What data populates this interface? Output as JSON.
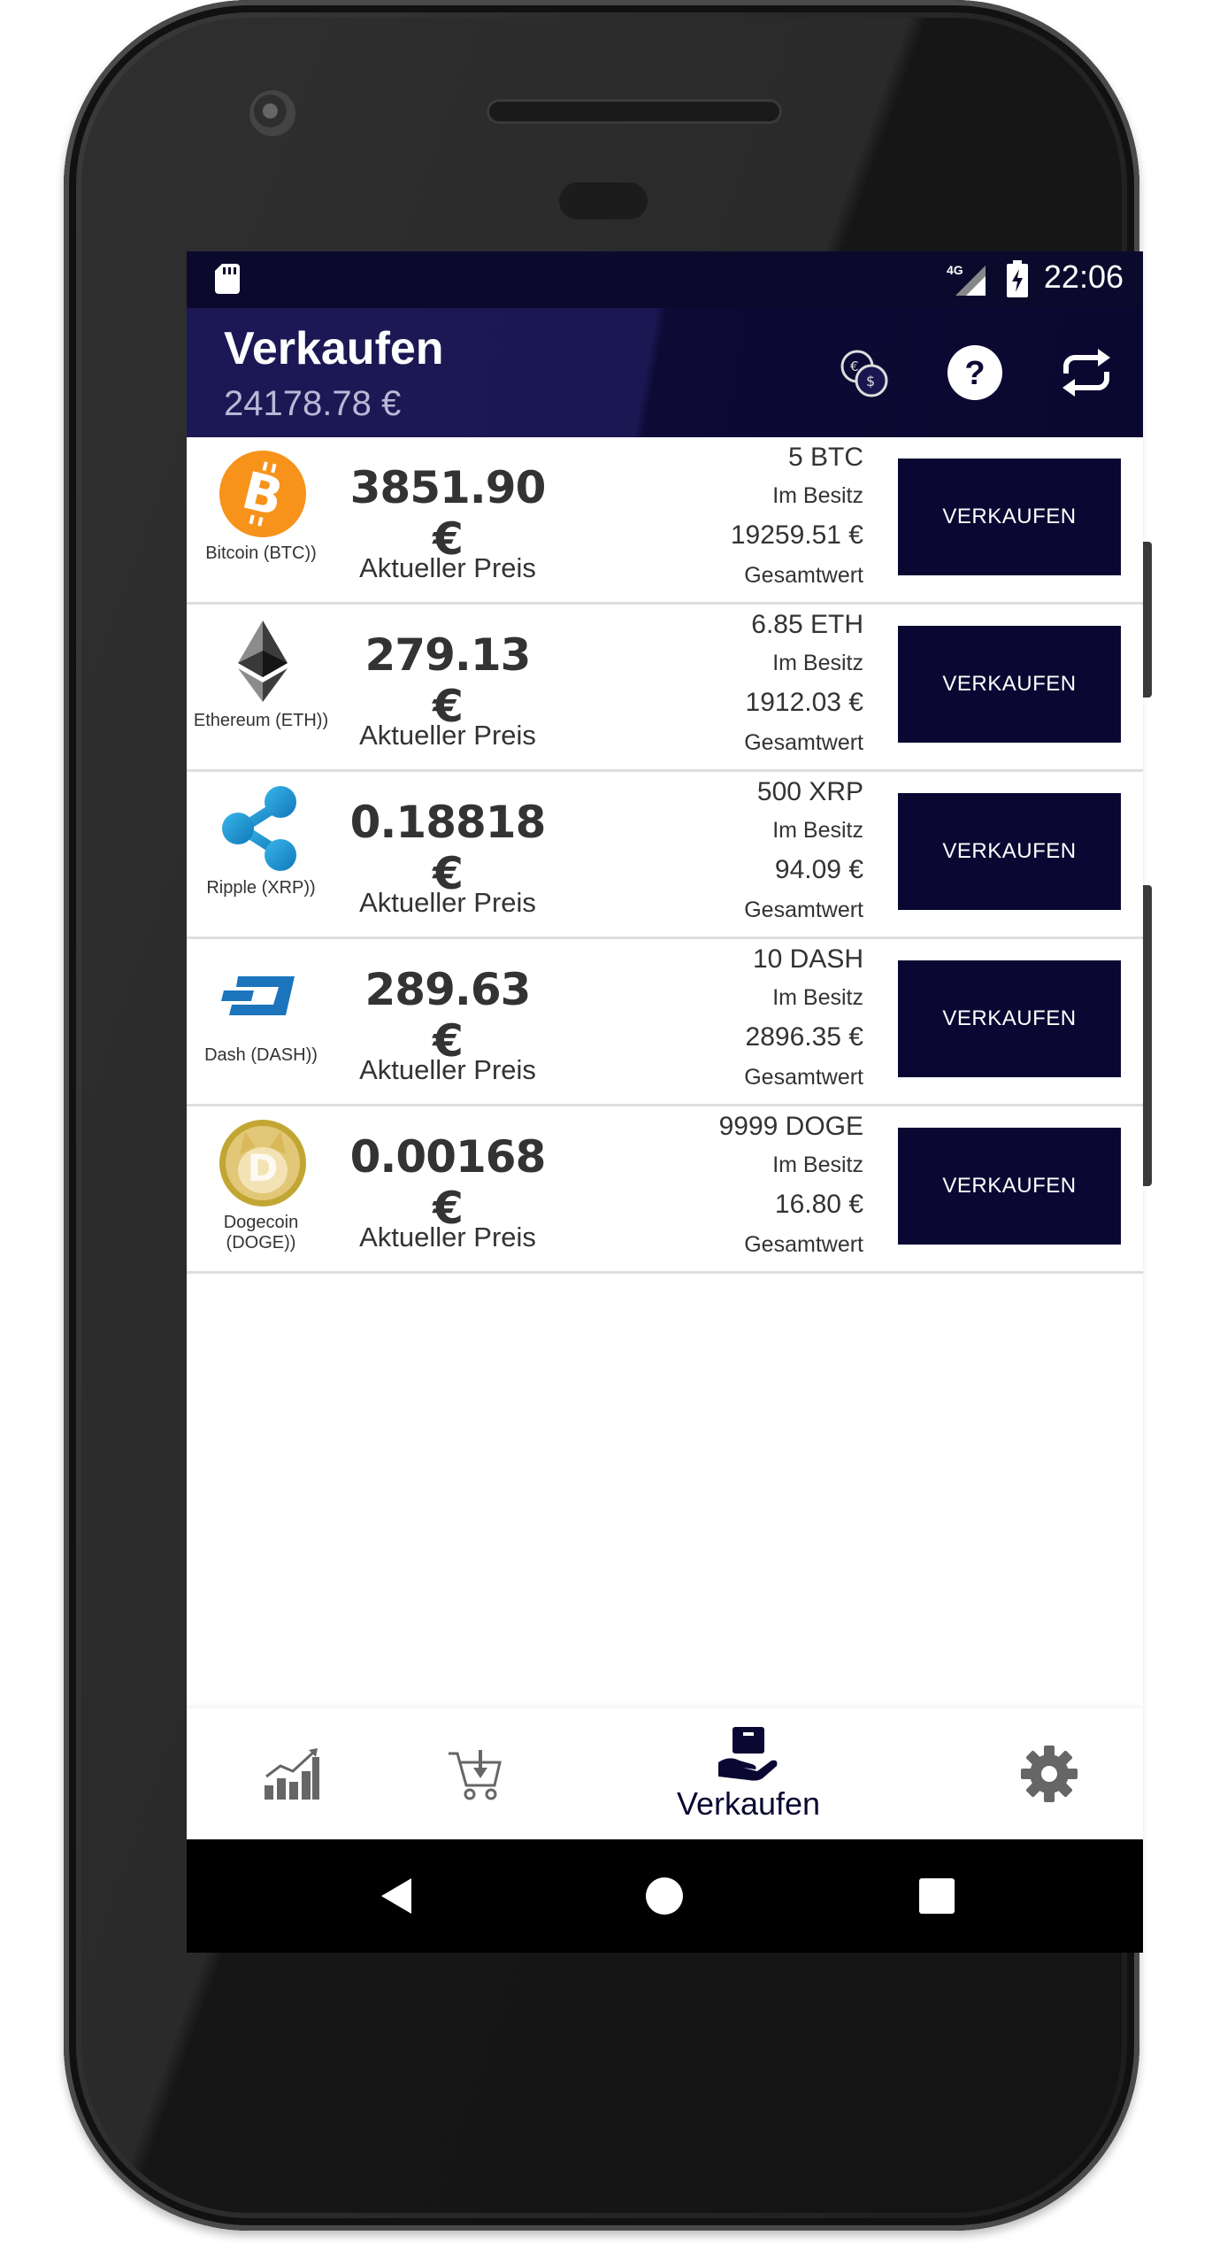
{
  "status_bar": {
    "time": "22:06",
    "network": "4G"
  },
  "app_bar": {
    "title": "Verkaufen",
    "portfolio_total": "24178.78 €",
    "actions": [
      "currency-exchange-icon",
      "help-icon",
      "refresh-icon"
    ]
  },
  "coins": [
    {
      "name": "Bitcoin (BTC))",
      "icon": "bitcoin-icon",
      "price": "3851.90 €",
      "price_label": "Aktueller Preis",
      "amount": "5 BTC",
      "owned_label": "Im Besitz",
      "total": "19259.51 €",
      "total_label": "Gesamtwert",
      "button": "VERKAUFEN"
    },
    {
      "name": "Ethereum (ETH))",
      "icon": "ethereum-icon",
      "price": "279.13 €",
      "price_label": "Aktueller Preis",
      "amount": "6.85 ETH",
      "owned_label": "Im Besitz",
      "total": "1912.03 €",
      "total_label": "Gesamtwert",
      "button": "VERKAUFEN"
    },
    {
      "name": "Ripple (XRP))",
      "icon": "ripple-icon",
      "price": "0.18818 €",
      "price_label": "Aktueller Preis",
      "amount": "500 XRP",
      "owned_label": "Im Besitz",
      "total": "94.09 €",
      "total_label": "Gesamtwert",
      "button": "VERKAUFEN"
    },
    {
      "name": "Dash (DASH))",
      "icon": "dash-icon",
      "price": "289.63 €",
      "price_label": "Aktueller Preis",
      "amount": "10 DASH",
      "owned_label": "Im Besitz",
      "total": "2896.35 €",
      "total_label": "Gesamtwert",
      "button": "VERKAUFEN"
    },
    {
      "name": "Dogecoin (DOGE))",
      "icon": "dogecoin-icon",
      "price": "0.00168 €",
      "price_label": "Aktueller Preis",
      "amount": "9999 DOGE",
      "owned_label": "Im Besitz",
      "total": "16.80 €",
      "total_label": "Gesamtwert",
      "button": "VERKAUFEN"
    }
  ],
  "bottom_nav": {
    "items": [
      {
        "icon": "chart-icon",
        "label": ""
      },
      {
        "icon": "cart-icon",
        "label": ""
      },
      {
        "icon": "sell-icon",
        "label": "Verkaufen",
        "active": true
      },
      {
        "icon": "settings-icon",
        "label": ""
      }
    ]
  },
  "colors": {
    "primary": "#0a0832",
    "app_bar": "#1c1856",
    "status_bar": "#0c0a2c"
  }
}
